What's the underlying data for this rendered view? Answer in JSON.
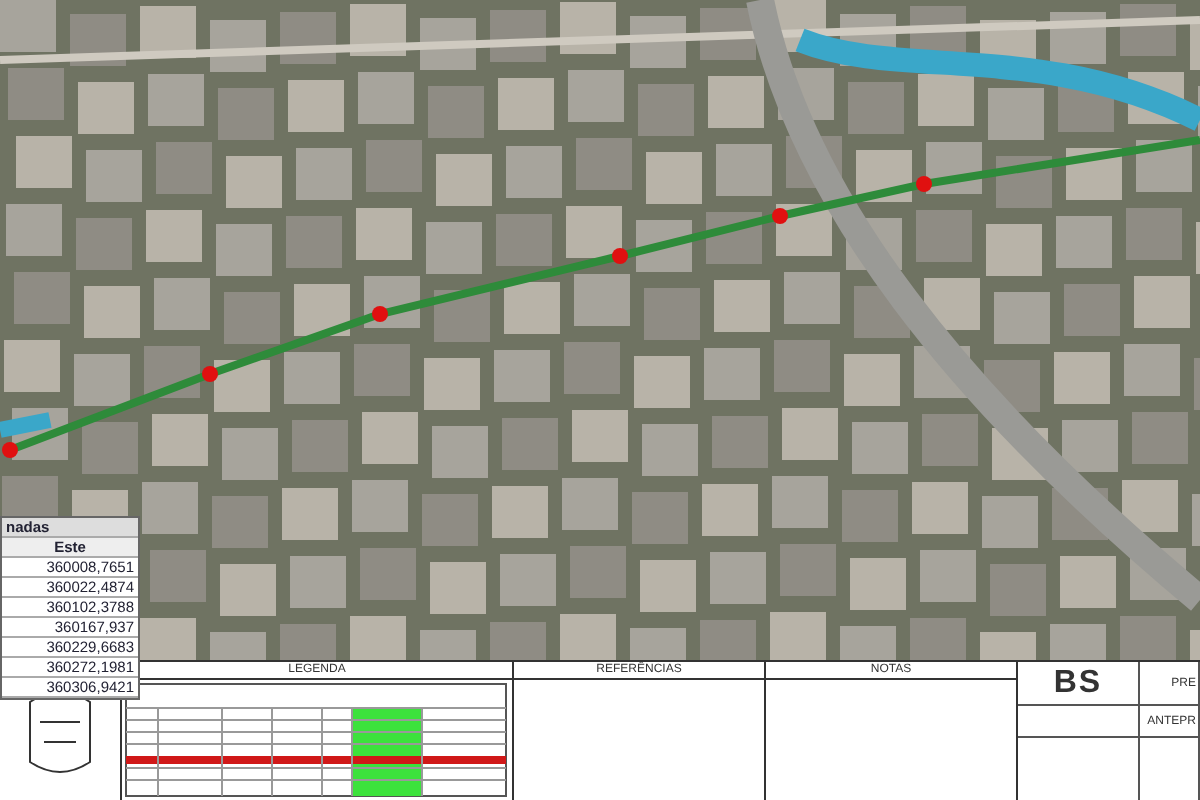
{
  "map": {
    "coordinates_table": {
      "title": "nadas",
      "column": "Este",
      "values": [
        "360008,7651",
        "360022,4874",
        "360102,3788",
        "360167,937",
        "360229,6683",
        "360272,1981",
        "360306,9421"
      ]
    }
  },
  "title_block": {
    "legend": {
      "title": "LEGENDA"
    },
    "references": {
      "title": "REFERÊNCIAS"
    },
    "notes": {
      "title": "NOTAS"
    },
    "logo": "BS",
    "project_phase": "ANTEPR",
    "sheet_label": "PRE"
  }
}
